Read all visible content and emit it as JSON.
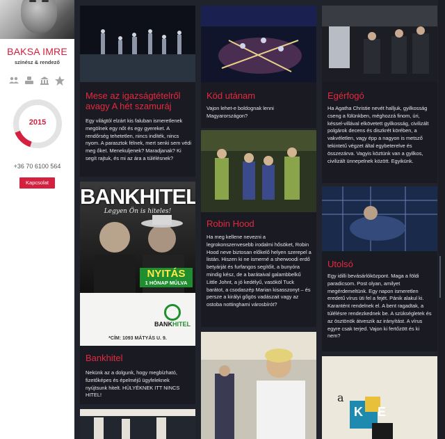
{
  "profile": {
    "name": "BAKSA IMRE",
    "role": "színész & rendező",
    "year": "2015",
    "year_progress": 0.14,
    "phone": "+36 70 6100 564",
    "contact_label": "Kapcsolat",
    "icons": [
      "people-icon",
      "audience-icon",
      "bank-icon",
      "star-icon"
    ]
  },
  "colors": {
    "accent": "#d3213f",
    "card_bg": "#1a1b22",
    "page_bg": "#20222c"
  },
  "cards": {
    "mese": {
      "title": "Mese az igazságtételről avagy A hét szamuráj",
      "text": "Egy világtól elzárt kis faluban ismeretlenek megölnek egy nőt és egy gyereket. A rendőrség tehetetlen, nincs indíték, nincs nyom. A parasztok félnek, mert senki sem védi meg őket. Menekuljenek? Maradjanak? Ki segít rajtuk, és mi az ára a túlélésnek?"
    },
    "bankhitel": {
      "title": "Bankhitel",
      "text": "Nekünk az a dolgunk, hogy megbízható, fizetőképes és épelméjű ügyfeleknek nyújtsunk hitelt. HÜLYÉKNEK ITT NINCS HITEL!",
      "poster": {
        "brand": "BANKHITEL",
        "slogan": "Legyen Ön is hiteles!",
        "opening": "NYITÁS",
        "opening_sub": "1 HÓNAP MÚLVA",
        "address": "*CÍM: 1093 MÁTYÁS U. 9."
      }
    },
    "kod": {
      "title": "Köd utánam",
      "text": "Vajon lehet-e boldognak lenni Magyarországon?"
    },
    "robin": {
      "title": "Robin Hood",
      "text": "Ha meg kellene nevezni a legrokonszenvesebb irodalmi hősöket, Robin Hood neve biztosan előkelő helyen szerepel a listán. Hiszen ki ne ismerné a sherwoodi erdő betyárját és furfangos segítőit, a bunyóra mindig kész, de a barátaival galambbelkű Little Johnt, a jó kedélyű, vasököl Tuck barátot, a csodaszép Marian kisasszonyt – és persze a királyi gőgös vadászait vagy az ostoba nottinghami városbírót?"
    },
    "eger": {
      "title": "Egérfogó",
      "text": "Ha Agatha Christie nevét halljuk, gyilkosság cseng a fülünkben, méghozzá finom, úri, késsel-villával elkövetett gyilkosság, civilizált polgárok decens és diszkrét körében, a vakvéletlen, vagy épp a nagyon is metsző tekintetű végzet által egybeterelve és összezárva. Vagyis köztünk van a gyilkos, civilizált ünnepelnek között. Egyikünk."
    },
    "utolso": {
      "title": "Utolsó",
      "text": "Egy idilli bevásárlóközpont. Maga a földi paradicsom. Post olyan, amilyet megérdemeltünk. Egy napon ismeretlen eredetű vírus üti fel a fejét. Pánik alakul ki. Karantént rendelnek el. A bent ragadtak, a túlélésre rendezkednek be. A szükségletek és az ösztönök átveszik az irányítást. A vírus egyre csak terjed. Vajon ki fertőzött és ki nem?"
    },
    "book": {
      "letter": "a",
      "letters": "K E"
    }
  }
}
